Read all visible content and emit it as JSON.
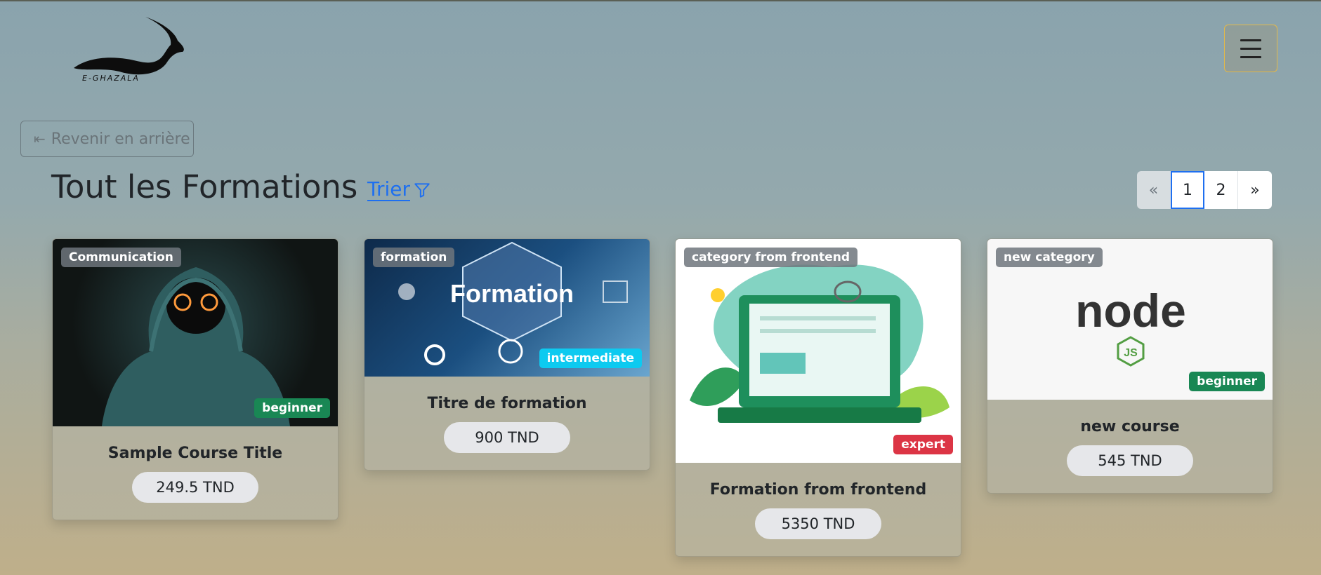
{
  "header": {
    "brand_text": "E-GHAZALA"
  },
  "nav": {
    "back_label": "Revenir en arrière"
  },
  "page": {
    "title": "Tout les Formations",
    "sort_label": "Trier"
  },
  "pagination": {
    "prev": "«",
    "pages": [
      "1",
      "2"
    ],
    "next": "»",
    "active": "1"
  },
  "courses": [
    {
      "category": "Communication",
      "level": "beginner",
      "level_color": "#198754",
      "title": "Sample Course Title",
      "price": "249.5 TND"
    },
    {
      "category": "formation",
      "level": "intermediate",
      "level_color": "#0dcaf0",
      "title": "Titre de formation",
      "price": "900 TND",
      "image_text": "Formation"
    },
    {
      "category": "category from frontend",
      "level": "expert",
      "level_color": "#dc3545",
      "title": "Formation from frontend",
      "price": "5350 TND"
    },
    {
      "category": "new category",
      "level": "beginner",
      "level_color": "#198754",
      "title": "new course",
      "price": "545 TND",
      "image_text": "node",
      "image_subtext": "JS"
    }
  ]
}
